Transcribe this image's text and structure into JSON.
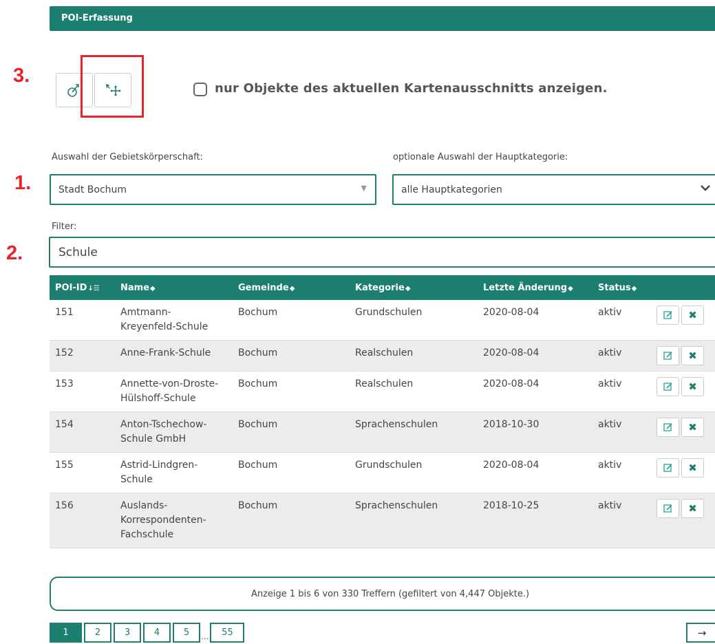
{
  "header": {
    "title": "POI-Erfassung"
  },
  "steps": {
    "one": "1.",
    "two": "2.",
    "three": "3."
  },
  "toolbar": {
    "tool1_icon": "cursor-link-icon",
    "tool2_icon": "move-arrows-icon",
    "checkbox_label": "nur Objekte des aktuellen Kartenausschnitts anzeigen.",
    "checkbox_checked": false
  },
  "form": {
    "region_label": "Auswahl der Gebietskörperschaft:",
    "region_value": "Stadt Bochum",
    "category_label": "optionale Auswahl der Hauptkategorie:",
    "category_value": "alle Hauptkategorien",
    "filter_label": "Filter:",
    "filter_value": "Schule"
  },
  "table": {
    "columns": [
      "POI-ID",
      "Name",
      "Gemeinde",
      "Kategorie",
      "Letzte Änderung",
      "Status"
    ],
    "rows": [
      {
        "id": "151",
        "name": "Amtmann-Kreyenfeld-Schule",
        "gemeinde": "Bochum",
        "kategorie": "Grundschulen",
        "aenderung": "2020-08-04",
        "status": "aktiv"
      },
      {
        "id": "152",
        "name": "Anne-Frank-Schule",
        "gemeinde": "Bochum",
        "kategorie": "Realschulen",
        "aenderung": "2020-08-04",
        "status": "aktiv"
      },
      {
        "id": "153",
        "name": "Annette-von-Droste-Hülshoff-Schule",
        "gemeinde": "Bochum",
        "kategorie": "Realschulen",
        "aenderung": "2020-08-04",
        "status": "aktiv"
      },
      {
        "id": "154",
        "name": "Anton-Tschechow-Schule GmbH",
        "gemeinde": "Bochum",
        "kategorie": "Sprachenschulen",
        "aenderung": "2018-10-30",
        "status": "aktiv"
      },
      {
        "id": "155",
        "name": "Astrid-Lindgren-Schule",
        "gemeinde": "Bochum",
        "kategorie": "Grundschulen",
        "aenderung": "2020-08-04",
        "status": "aktiv"
      },
      {
        "id": "156",
        "name": "Auslands-Korrespondenten-Fachschule",
        "gemeinde": "Bochum",
        "kategorie": "Sprachenschulen",
        "aenderung": "2018-10-25",
        "status": "aktiv"
      }
    ]
  },
  "info": {
    "text": "Anzeige 1 bis 6 von 330 Treffern (gefiltert von 4,447 Objekte.)"
  },
  "pagination": {
    "pages": [
      "1",
      "2",
      "3",
      "4",
      "5"
    ],
    "ellipsis": "...",
    "last": "55",
    "current": "1",
    "next": "→"
  },
  "colors": {
    "accent": "#1b7e6f",
    "highlight": "#e8232a"
  }
}
